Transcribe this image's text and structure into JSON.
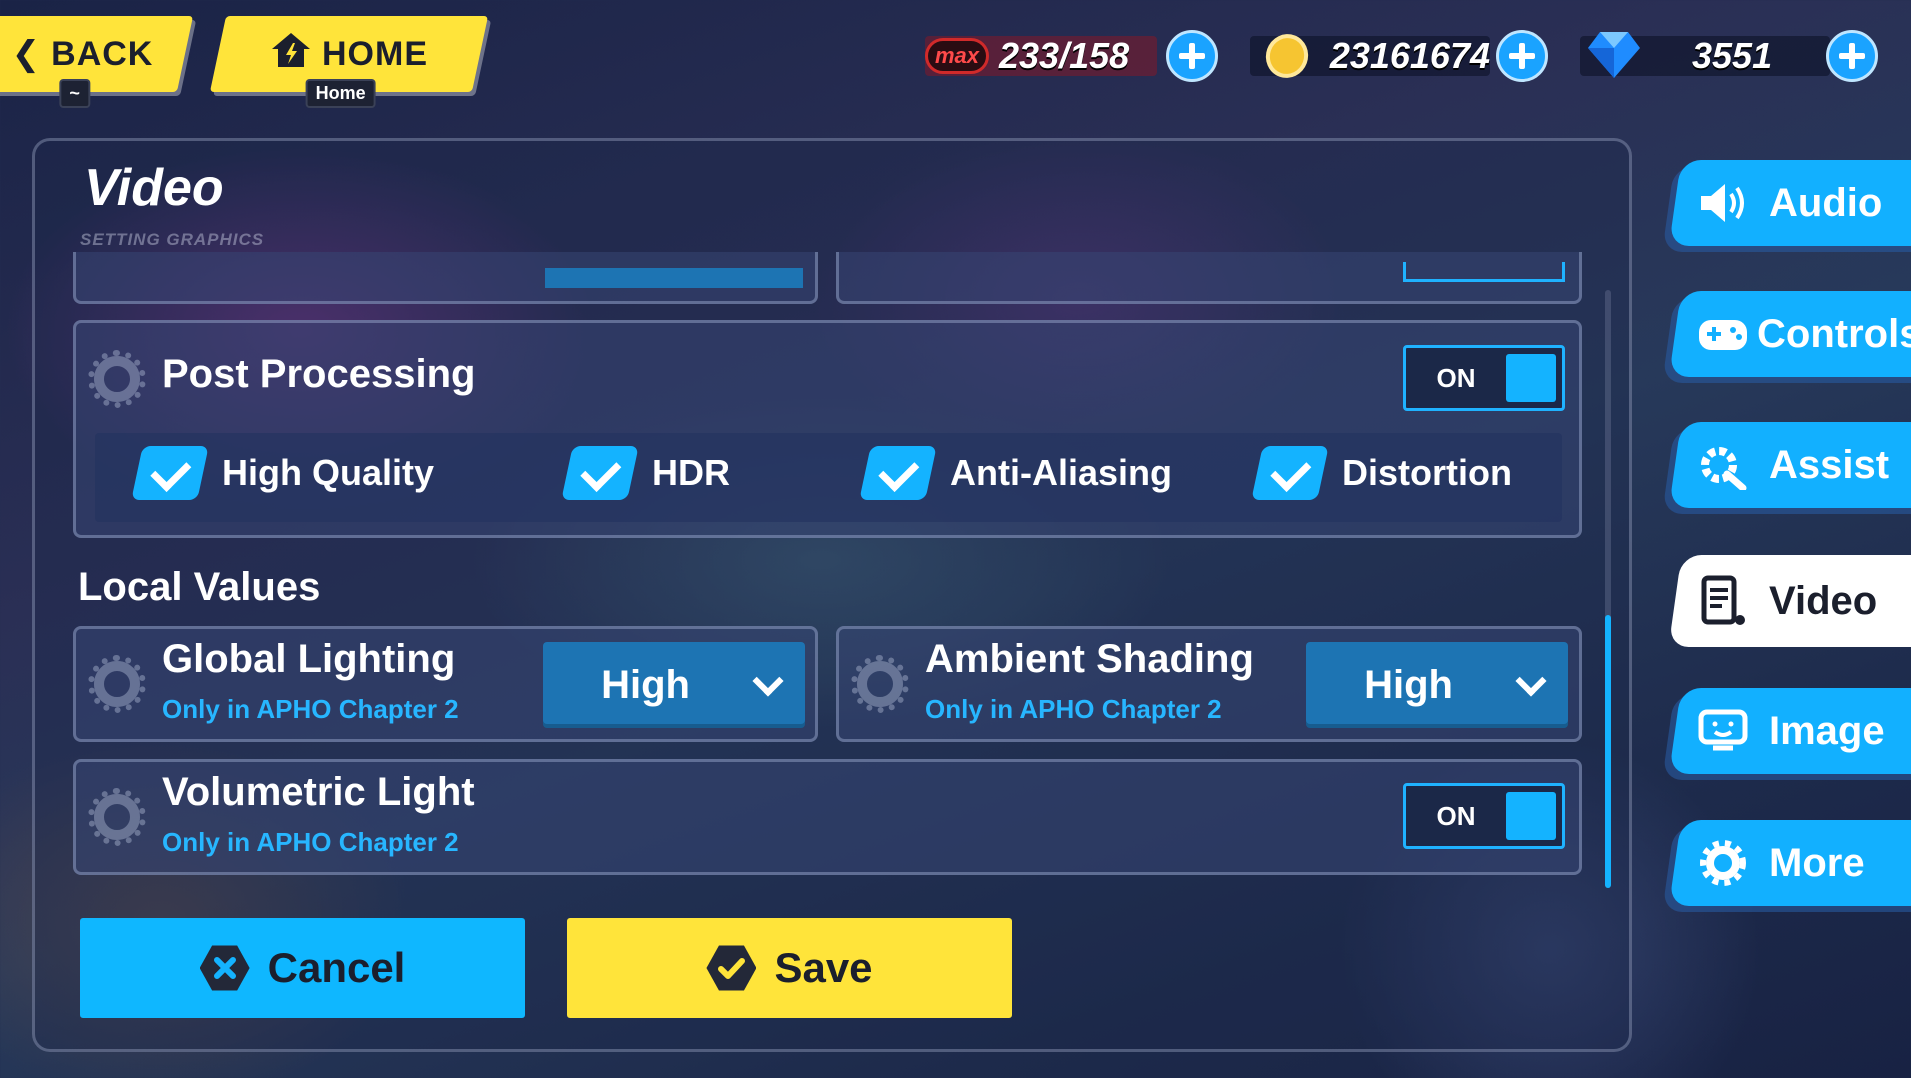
{
  "topbar": {
    "back_label": "BACK",
    "back_hotkey": "~",
    "home_label": "HOME",
    "home_hotkey": "Home"
  },
  "currencies": {
    "stamina_badge": "max",
    "stamina_value": "233/158",
    "coins_value": "23161674",
    "crystals_value": "3551"
  },
  "panel": {
    "title": "Video",
    "subtitle": "SETTING GRAPHICS"
  },
  "post_processing": {
    "label": "Post Processing",
    "toggle": "ON",
    "options": [
      {
        "label": "High Quality",
        "checked": true
      },
      {
        "label": "HDR",
        "checked": true
      },
      {
        "label": "Anti-Aliasing",
        "checked": true
      },
      {
        "label": "Distortion",
        "checked": true
      }
    ]
  },
  "local_values": {
    "heading": "Local Values",
    "global_lighting": {
      "label": "Global Lighting",
      "note": "Only in APHO Chapter 2",
      "value": "High"
    },
    "ambient_shading": {
      "label": "Ambient Shading",
      "note": "Only in APHO Chapter 2",
      "value": "High"
    },
    "volumetric_light": {
      "label": "Volumetric Light",
      "note": "Only in APHO Chapter 2",
      "toggle": "ON"
    }
  },
  "actions": {
    "cancel": "Cancel",
    "save": "Save"
  },
  "tabs": [
    {
      "label": "Audio",
      "icon": "speaker-icon",
      "active": false
    },
    {
      "label": "Controls",
      "icon": "gamepad-icon",
      "active": false
    },
    {
      "label": "Assist",
      "icon": "wrench-gear-icon",
      "active": false
    },
    {
      "label": "Video",
      "icon": "device-icon",
      "active": true
    },
    {
      "label": "Image",
      "icon": "monitor-icon",
      "active": false
    },
    {
      "label": "More",
      "icon": "gear-icon",
      "active": false
    }
  ],
  "colors": {
    "accent_blue": "#14b3ff",
    "accent_yellow": "#ffe43a",
    "sub_text": "#27b6ff"
  }
}
